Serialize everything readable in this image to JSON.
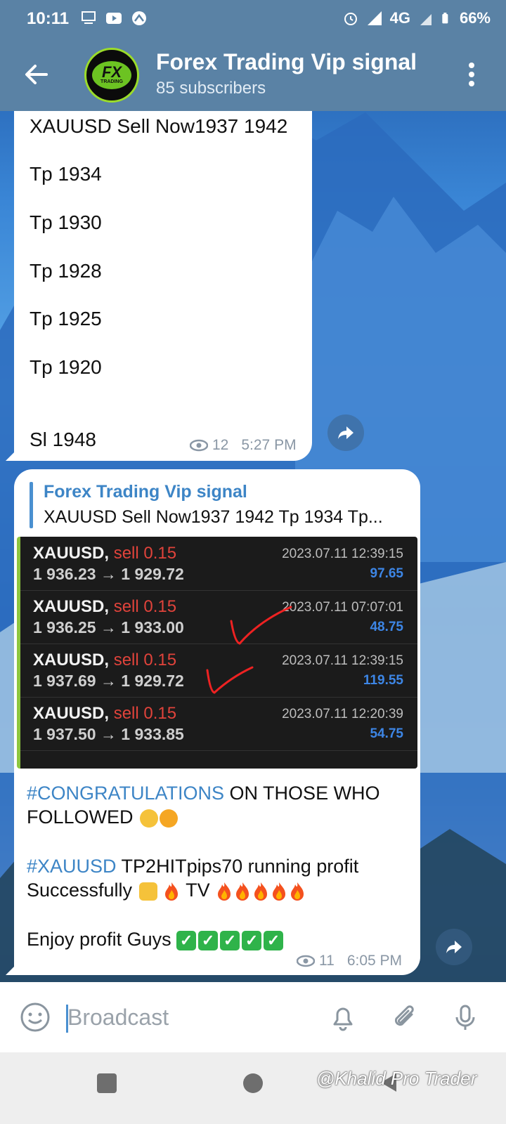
{
  "status_bar": {
    "time": "10:11",
    "network": "4G",
    "battery": "66%",
    "icons": [
      "notification-icon",
      "youtube-icon",
      "app-icon",
      "alarm-icon",
      "signal-icon",
      "battery-icon"
    ]
  },
  "header": {
    "title": "Forex Trading Vip signal",
    "subtitle": "85 subscribers",
    "avatar_text": "FX",
    "avatar_subtext": "TRADING"
  },
  "message1": {
    "lines": [
      "XAUUSD Sell Now1937 1942",
      "Tp 1934",
      "Tp 1930",
      "Tp 1928",
      "Tp 1925",
      "Tp 1920",
      "Sl 1948"
    ],
    "views": "12",
    "time": "5:27 PM"
  },
  "message2": {
    "forward_name": "Forex Trading Vip signal",
    "forward_text": "XAUUSD Sell Now1937 1942  Tp 1934  Tp...",
    "trades": [
      {
        "symbol": "XAUUSD,",
        "side": "sell 0.15",
        "prices": "1 936.23 → 1 929.72",
        "date": "2023.07.11 12:39:15",
        "profit": "97.65"
      },
      {
        "symbol": "XAUUSD,",
        "side": "sell 0.15",
        "prices": "1 936.25 → 1 933.00",
        "date": "2023.07.11 07:07:01",
        "profit": "48.75"
      },
      {
        "symbol": "XAUUSD,",
        "side": "sell 0.15",
        "prices": "1 937.69 → 1 929.72",
        "date": "2023.07.11 12:39:15",
        "profit": "119.55"
      },
      {
        "symbol": "XAUUSD,",
        "side": "sell 0.15",
        "prices": "1 937.50 → 1 933.85",
        "date": "2023.07.11 12:20:39",
        "profit": "54.75"
      }
    ],
    "hashtag1": "#CONGRATULATIONS",
    "text1": " ON THOSE WHO FOLLOWED ",
    "hashtag2": "#XAUUSD",
    "text2a": "   TP2HITpips70 running profit",
    "text2b": "Successfully ",
    "text2c": " TV",
    "text3": "Enjoy profit Guys ",
    "views": "11",
    "time": "6:05 PM"
  },
  "input": {
    "placeholder": "Broadcast"
  },
  "watermark": "@Khalid Pro Trader",
  "colors": {
    "header_bg": "#5a82a5",
    "link": "#3d85c6",
    "sell": "#e0433b",
    "profit": "#3d86e6"
  }
}
